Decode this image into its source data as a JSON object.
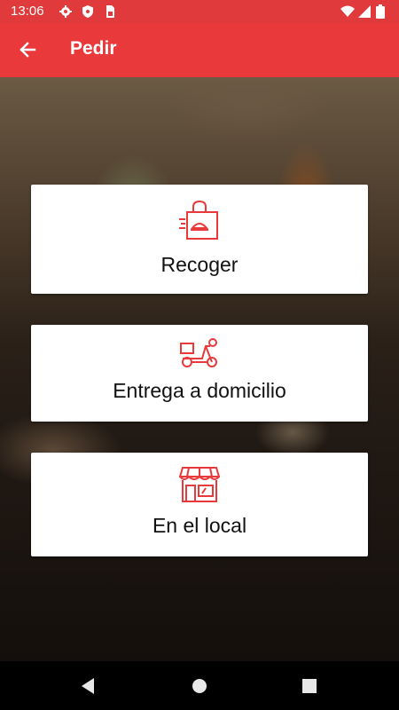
{
  "status_bar": {
    "time": "13:06",
    "icons": [
      "gear-icon",
      "shield-icon",
      "sim-card-icon",
      "wifi-icon",
      "signal-icon",
      "battery-icon"
    ]
  },
  "app_bar": {
    "title": "Pedir",
    "back_icon": "arrow-left-icon",
    "color": "#e9393b"
  },
  "options": [
    {
      "label": "Recoger",
      "icon": "takeaway-bag-icon"
    },
    {
      "label": "Entrega a domicilio",
      "icon": "delivery-scooter-icon"
    },
    {
      "label": "En el local",
      "icon": "storefront-icon"
    }
  ],
  "accent_color": "#e9393b",
  "nav_bar": {
    "buttons": [
      "back-triangle-icon",
      "home-circle-icon",
      "recents-square-icon"
    ]
  }
}
